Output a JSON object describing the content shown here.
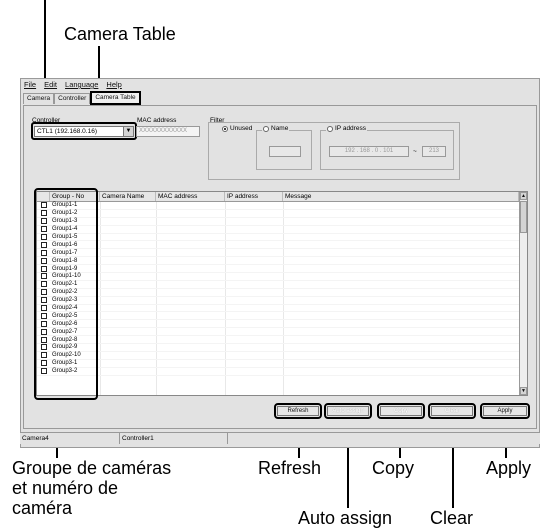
{
  "menubar": {
    "file": "File",
    "edit": "Edit",
    "language": "Language",
    "help": "Help"
  },
  "tabs": [
    "Camera",
    "Controller",
    "Camera Table"
  ],
  "controller": {
    "label": "Controller",
    "value": "CTL1 (192.168.0.16)"
  },
  "mac": {
    "label": "MAC address",
    "value": "XXXXXXXXXXXX"
  },
  "filter": {
    "label": "Filter",
    "unused": "Unused",
    "name": "Name",
    "ip": "IP address",
    "ip_from": "192 . 168 . 0 . 101",
    "ip_to": "213"
  },
  "table": {
    "headers": [
      "Group - No",
      "Camera Name",
      "MAC address",
      "IP address",
      "Message"
    ],
    "rows": [
      "Group1-1",
      "Group1-2",
      "Group1-3",
      "Group1-4",
      "Group1-5",
      "Group1-6",
      "Group1-7",
      "Group1-8",
      "Group1-9",
      "Group1-10",
      "Group2-1",
      "Group2-2",
      "Group2-3",
      "Group2-4",
      "Group2-5",
      "Group2-6",
      "Group2-7",
      "Group2-8",
      "Group2-9",
      "Group2-10",
      "Group3-1",
      "Group3-2"
    ]
  },
  "buttons": {
    "refresh": "Refresh",
    "auto_assign": "Auto assign",
    "copy": "Copy",
    "clear": "Clear",
    "apply": "Apply"
  },
  "status": {
    "camera": "Camera4",
    "controller": "Controller1"
  },
  "callouts": {
    "camera_table": "Camera Table",
    "group": "Groupe de caméras\net numéro de\ncaméra",
    "refresh": "Refresh",
    "copy": "Copy",
    "apply": "Apply",
    "auto_assign": "Auto assign",
    "clear": "Clear"
  }
}
